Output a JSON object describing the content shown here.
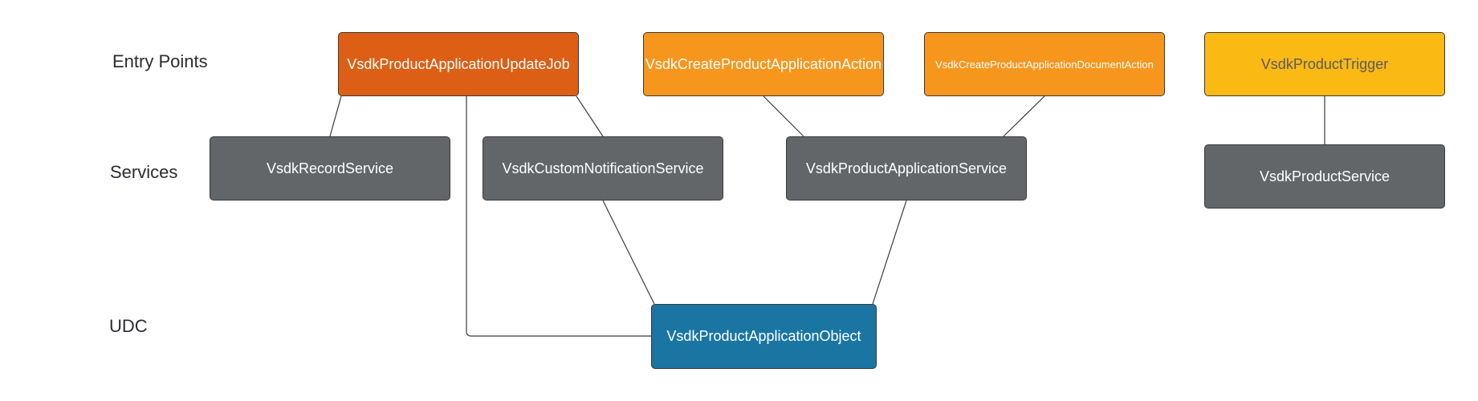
{
  "rows": {
    "entry_points": "Entry Points",
    "services": "Services",
    "udc": "UDC"
  },
  "nodes": {
    "update_job": "VsdkProductApplicationUpdateJob",
    "create_action": "VsdkCreateProductApplicationAction",
    "document_action": "VsdkCreateProductApplicationDocumentAction",
    "trigger": "VsdkProductTrigger",
    "record_service": "VsdkRecordService",
    "notification_service": "VsdkCustomNotificationService",
    "application_service": "VsdkProductApplicationService",
    "product_service": "VsdkProductService",
    "application_object": "VsdkProductApplicationObject"
  },
  "colors": {
    "job": "#dc5f15",
    "action": "#f7961d",
    "trigger": "#fbb914",
    "service": "#636669",
    "udc": "#1a75a3"
  }
}
